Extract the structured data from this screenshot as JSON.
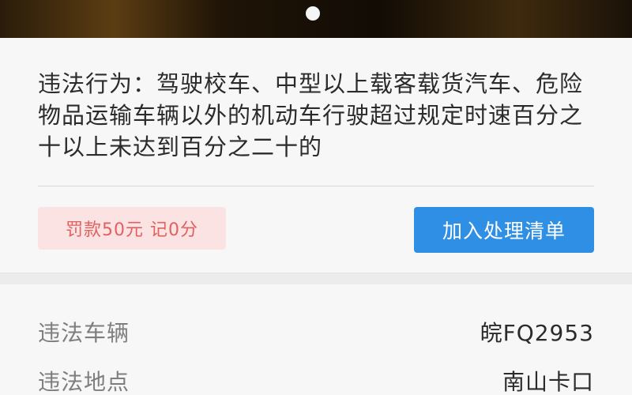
{
  "violation": {
    "label": "违法行为：",
    "description": "驾驶校车、中型以上载客载货汽车、危险物品运输车辆以外的机动车行驶超过规定时速百分之十以上未达到百分之二十的"
  },
  "penalty": {
    "text": "罚款50元 记0分"
  },
  "actions": {
    "add_to_list_label": "加入处理清单"
  },
  "details": [
    {
      "label": "违法车辆",
      "value": "皖FQ2953"
    },
    {
      "label": "违法地点",
      "value": "南山卡口"
    }
  ],
  "colors": {
    "accent": "#2f8fe4",
    "penalty_text": "#e0615e",
    "penalty_bg": "#fbe3e3"
  }
}
